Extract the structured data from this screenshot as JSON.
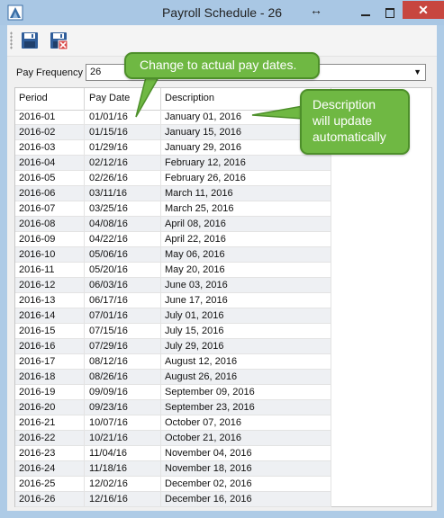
{
  "window": {
    "title": "Payroll Schedule - 26",
    "close_glyph": "✕",
    "resize_glyph": "↔"
  },
  "toolbar": {
    "save_icon": "floppy-save-icon",
    "discard_icon": "floppy-delete-icon"
  },
  "pay_frequency": {
    "label": "Pay Frequency",
    "value": "26"
  },
  "grid": {
    "columns": [
      "Period",
      "Pay Date",
      "Description"
    ],
    "rows": [
      [
        "2016-01",
        "01/01/16",
        "January 01, 2016"
      ],
      [
        "2016-02",
        "01/15/16",
        "January 15, 2016"
      ],
      [
        "2016-03",
        "01/29/16",
        "January 29, 2016"
      ],
      [
        "2016-04",
        "02/12/16",
        "February 12, 2016"
      ],
      [
        "2016-05",
        "02/26/16",
        "February 26, 2016"
      ],
      [
        "2016-06",
        "03/11/16",
        "March 11, 2016"
      ],
      [
        "2016-07",
        "03/25/16",
        "March 25, 2016"
      ],
      [
        "2016-08",
        "04/08/16",
        "April 08, 2016"
      ],
      [
        "2016-09",
        "04/22/16",
        "April 22, 2016"
      ],
      [
        "2016-10",
        "05/06/16",
        "May 06, 2016"
      ],
      [
        "2016-11",
        "05/20/16",
        "May 20, 2016"
      ],
      [
        "2016-12",
        "06/03/16",
        "June 03, 2016"
      ],
      [
        "2016-13",
        "06/17/16",
        "June 17, 2016"
      ],
      [
        "2016-14",
        "07/01/16",
        "July 01, 2016"
      ],
      [
        "2016-15",
        "07/15/16",
        "July 15, 2016"
      ],
      [
        "2016-16",
        "07/29/16",
        "July 29, 2016"
      ],
      [
        "2016-17",
        "08/12/16",
        "August 12, 2016"
      ],
      [
        "2016-18",
        "08/26/16",
        "August 26, 2016"
      ],
      [
        "2016-19",
        "09/09/16",
        "September 09, 2016"
      ],
      [
        "2016-20",
        "09/23/16",
        "September 23, 2016"
      ],
      [
        "2016-21",
        "10/07/16",
        "October 07, 2016"
      ],
      [
        "2016-22",
        "10/21/16",
        "October 21, 2016"
      ],
      [
        "2016-23",
        "11/04/16",
        "November 04, 2016"
      ],
      [
        "2016-24",
        "11/18/16",
        "November 18, 2016"
      ],
      [
        "2016-25",
        "12/02/16",
        "December 02, 2016"
      ],
      [
        "2016-26",
        "12/16/16",
        "December 16, 2016"
      ]
    ]
  },
  "callouts": {
    "pay_date": "Change to actual pay dates.",
    "description_lines": [
      "Description",
      "will update",
      "automatically"
    ]
  },
  "colors": {
    "callout_fill": "#6fb843",
    "close_button": "#c7463f",
    "titlebar": "#a9c7e4"
  }
}
